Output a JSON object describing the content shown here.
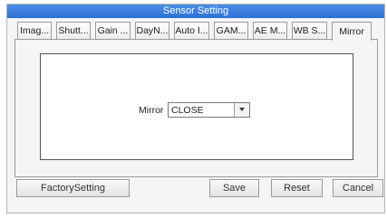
{
  "window": {
    "title": "Sensor Setting"
  },
  "tabs": [
    {
      "label": "Imag...",
      "active": false
    },
    {
      "label": "Shutt...",
      "active": false
    },
    {
      "label": "Gain ...",
      "active": false
    },
    {
      "label": "DayN...",
      "active": false
    },
    {
      "label": "Auto I...",
      "active": false
    },
    {
      "label": "GAM...",
      "active": false
    },
    {
      "label": "AE M...",
      "active": false
    },
    {
      "label": "WB S...",
      "active": false
    },
    {
      "label": "Mirror",
      "active": true
    }
  ],
  "mirror": {
    "label": "Mirror",
    "value": "CLOSE"
  },
  "buttons": {
    "factory": "FactorySetting",
    "save": "Save",
    "reset": "Reset",
    "cancel": "Cancel"
  },
  "colors": {
    "titlebar": "#2d70d4",
    "title_text": "#ffffff"
  }
}
